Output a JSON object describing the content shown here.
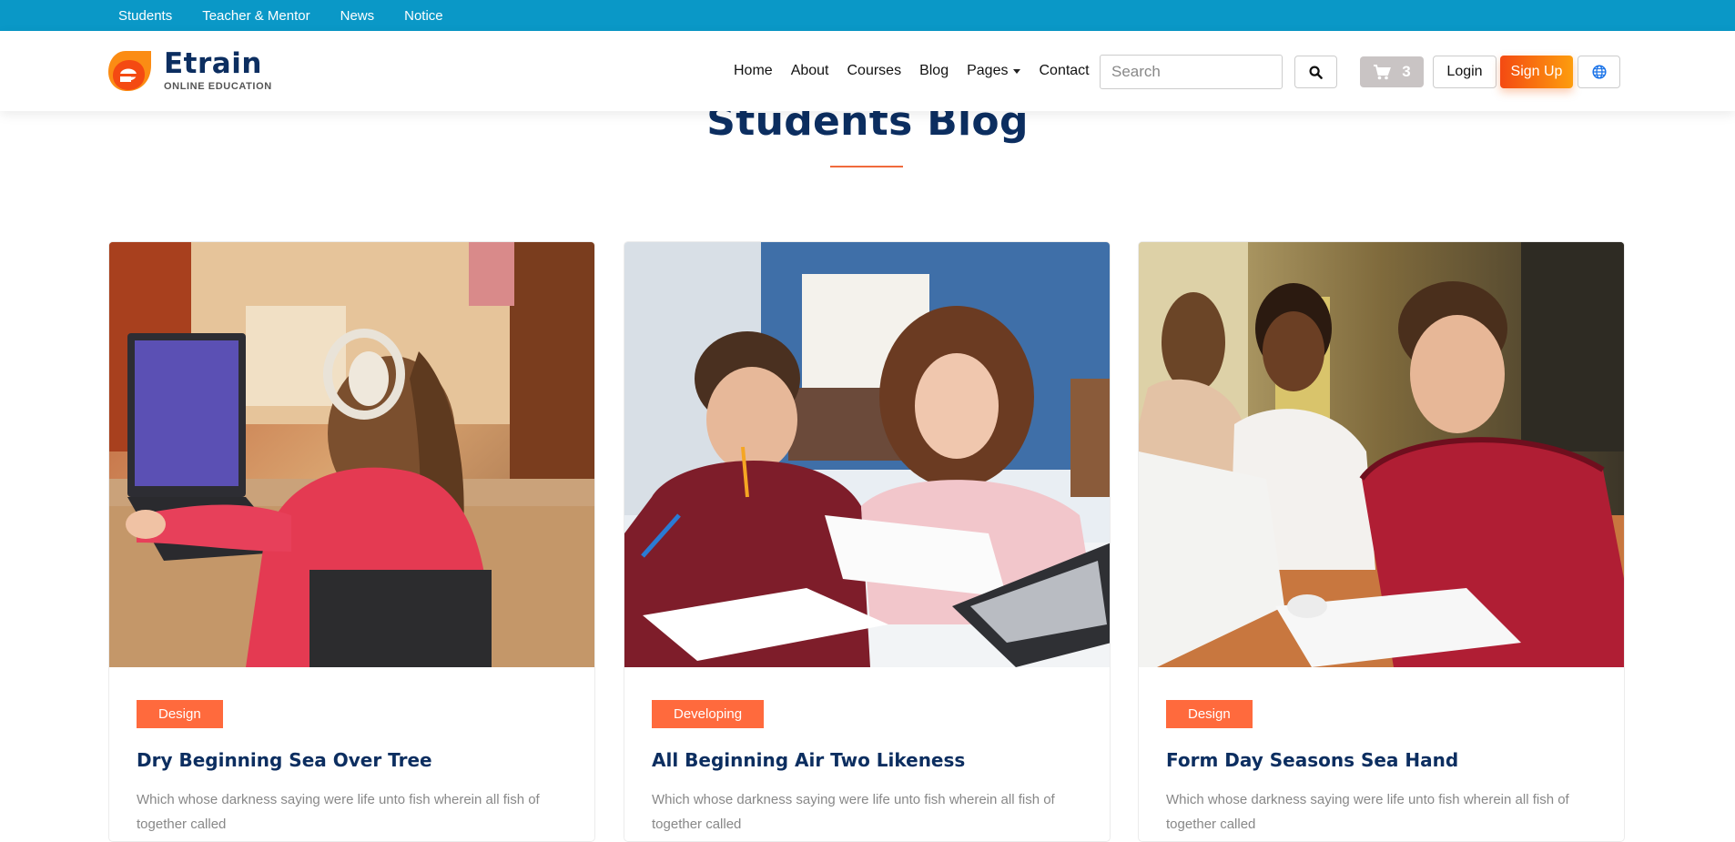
{
  "topbar": {
    "links": [
      "Students",
      "Teacher & Mentor",
      "News",
      "Notice"
    ]
  },
  "logo": {
    "name": "Etrain",
    "tagline": "ONLINE EDUCATION"
  },
  "nav": {
    "items": [
      "Home",
      "About",
      "Courses",
      "Blog",
      "Pages",
      "Contact"
    ]
  },
  "search": {
    "placeholder": "Search"
  },
  "cart": {
    "count": "3"
  },
  "auth": {
    "login_label": "Login",
    "signup_label": "Sign Up"
  },
  "section": {
    "title": "Students Blog"
  },
  "posts": [
    {
      "tag": "Design",
      "title": "Dry Beginning Sea Over Tree",
      "excerpt": "Which whose darkness saying were life unto fish wherein all fish of together called"
    },
    {
      "tag": "Developing",
      "title": "All Beginning Air Two Likeness",
      "excerpt": "Which whose darkness saying were life unto fish wherein all fish of together called"
    },
    {
      "tag": "Design",
      "title": "Form Day Seasons Sea Hand",
      "excerpt": "Which whose darkness saying were life unto fish wherein all fish of together called"
    }
  ],
  "colors": {
    "topbar": "#0a98c7",
    "brand_navy": "#0c2e60",
    "accent": "#ff6a3d"
  }
}
